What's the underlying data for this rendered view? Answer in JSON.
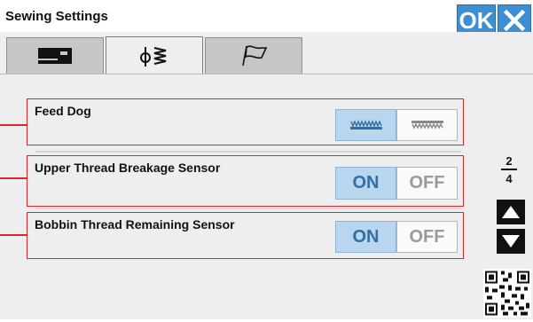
{
  "window": {
    "title": "Sewing Settings"
  },
  "header": {
    "ok_label": "OK",
    "close_icon": "close-icon"
  },
  "tabs": [
    {
      "icon": "sewing-machine-icon",
      "active": false
    },
    {
      "icon": "thread-tension-icon",
      "active": true
    },
    {
      "icon": "flag-icon",
      "active": false
    }
  ],
  "settings": {
    "feed_dog": {
      "label": "Feed Dog",
      "selected": "feed-dog-up"
    },
    "upper_thread": {
      "label": "Upper Thread Breakage Sensor",
      "on_label": "ON",
      "off_label": "OFF",
      "selected": "ON"
    },
    "bobbin_thread": {
      "label": "Bobbin Thread Remaining Sensor",
      "on_label": "ON",
      "off_label": "OFF",
      "selected": "ON"
    }
  },
  "pager": {
    "current": "2",
    "total": "4"
  },
  "colors": {
    "accent": "#3d8fd1",
    "selected": "#b9d6ee",
    "highlight": "#d9272e"
  }
}
